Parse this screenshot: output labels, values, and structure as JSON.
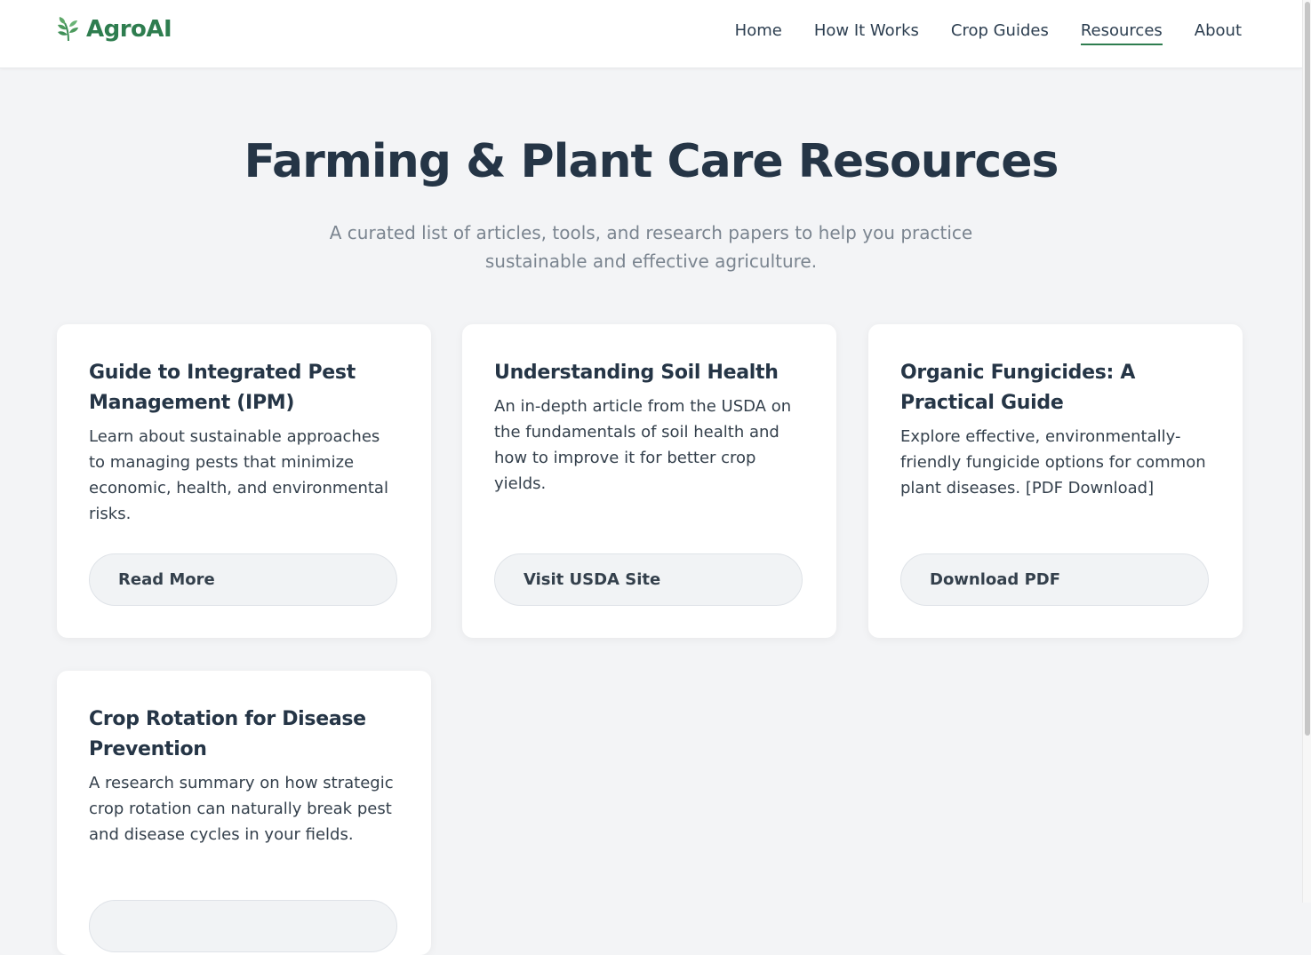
{
  "brand": {
    "name": "AgroAI",
    "icon": "leaf-icon",
    "color": "#2e7d4f"
  },
  "nav": {
    "items": [
      {
        "label": "Home"
      },
      {
        "label": "How It Works"
      },
      {
        "label": "Crop Guides"
      },
      {
        "label": "Resources",
        "active": true
      },
      {
        "label": "About"
      }
    ]
  },
  "hero": {
    "title": "Farming & Plant Care Resources",
    "subtitle": "A curated list of articles, tools, and research papers to help you practice sustainable and effective agriculture."
  },
  "cards": [
    {
      "title": "Guide to Integrated Pest Management (IPM)",
      "description": "Learn about sustainable approaches to managing pests that minimize economic, health, and environmental risks.",
      "button": "Read More"
    },
    {
      "title": "Understanding Soil Health",
      "description": "An in-depth article from the USDA on the fundamentals of soil health and how to improve it for better crop yields.",
      "button": "Visit USDA Site"
    },
    {
      "title": "Organic Fungicides: A Practical Guide",
      "description": "Explore effective, environmentally-friendly fungicide options for common plant diseases. [PDF Download]",
      "button": "Download PDF"
    },
    {
      "title": "Crop Rotation for Disease Prevention",
      "description": "A research summary on how strategic crop rotation can naturally break pest and disease cycles in your fields.",
      "button": ""
    }
  ]
}
